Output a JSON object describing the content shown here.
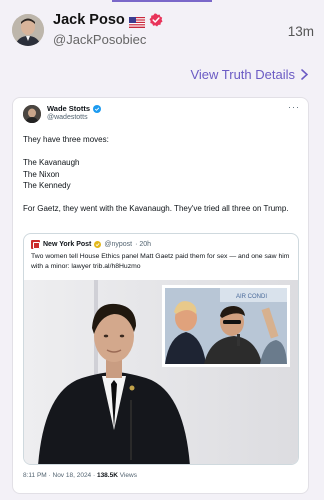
{
  "header": {
    "display_name": "Jack Poso",
    "handle": "@JackPosobiec",
    "timestamp": "13m",
    "view_link": "View Truth Details"
  },
  "embedded_tweet": {
    "author_name": "Wade Stotts",
    "author_handle": "@wadestotts",
    "more_label": "···",
    "lines": [
      "They have three moves:",
      "",
      "The Kavanaugh",
      "The Nixon",
      "The Kennedy",
      "",
      "For Gaetz, they went with the Kavanaugh. They've tried all three on Trump."
    ],
    "quoted": {
      "source_name": "New York Post",
      "source_handle": "@nypost",
      "age": "· 20h",
      "text": "Two women tell House Ethics panel Matt Gaetz paid them for sex — and one saw him with a minor: lawyer trib.al/h8Huzmo",
      "inset_sign_text": "AIR CONDI"
    },
    "footer": {
      "time_date": "8:11 PM · Nov 18, 2024 · ",
      "views_count": "138.5K",
      "views_label": " Views"
    }
  },
  "colors": {
    "page_bg": "#f3f1f7",
    "link": "#6b5bc4",
    "verified_badge": "#e8345a",
    "twitter_verified": "#1d9bf0"
  },
  "icons": [
    "us-flag-icon",
    "verified-badge-icon",
    "chevron-right-icon",
    "twitter-verified-icon",
    "more-options-icon",
    "nypost-logo-icon"
  ]
}
